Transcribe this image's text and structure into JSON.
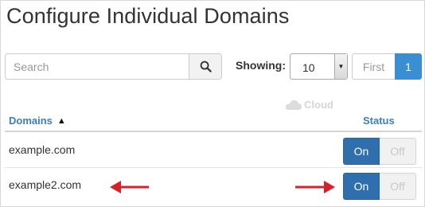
{
  "page": {
    "title": "Configure Individual Domains"
  },
  "search": {
    "placeholder": "Search",
    "value": ""
  },
  "pagination": {
    "showing_label": "Showing:",
    "per_page": "10",
    "first_label": "First",
    "current_page": "1"
  },
  "watermark": {
    "text": "Cloud"
  },
  "table": {
    "columns": {
      "domains": "Domains",
      "status": "Status"
    },
    "rows": [
      {
        "domain": "example.com",
        "on_label": "On",
        "off_label": "Off",
        "enabled": true
      },
      {
        "domain": "example2.com",
        "on_label": "On",
        "off_label": "Off",
        "enabled": true
      }
    ]
  },
  "colors": {
    "accent": "#3a8fd2",
    "toggle_on": "#2f6fae",
    "header_link": "#3a7fc1",
    "annotation_arrow": "#d9202a"
  },
  "icons": {
    "search": "search-icon",
    "sort": "sort-ascending-icon",
    "dropdown": "chevron-down-icon",
    "watermark": "cloud-icon",
    "annotation": "arrow-icon"
  }
}
